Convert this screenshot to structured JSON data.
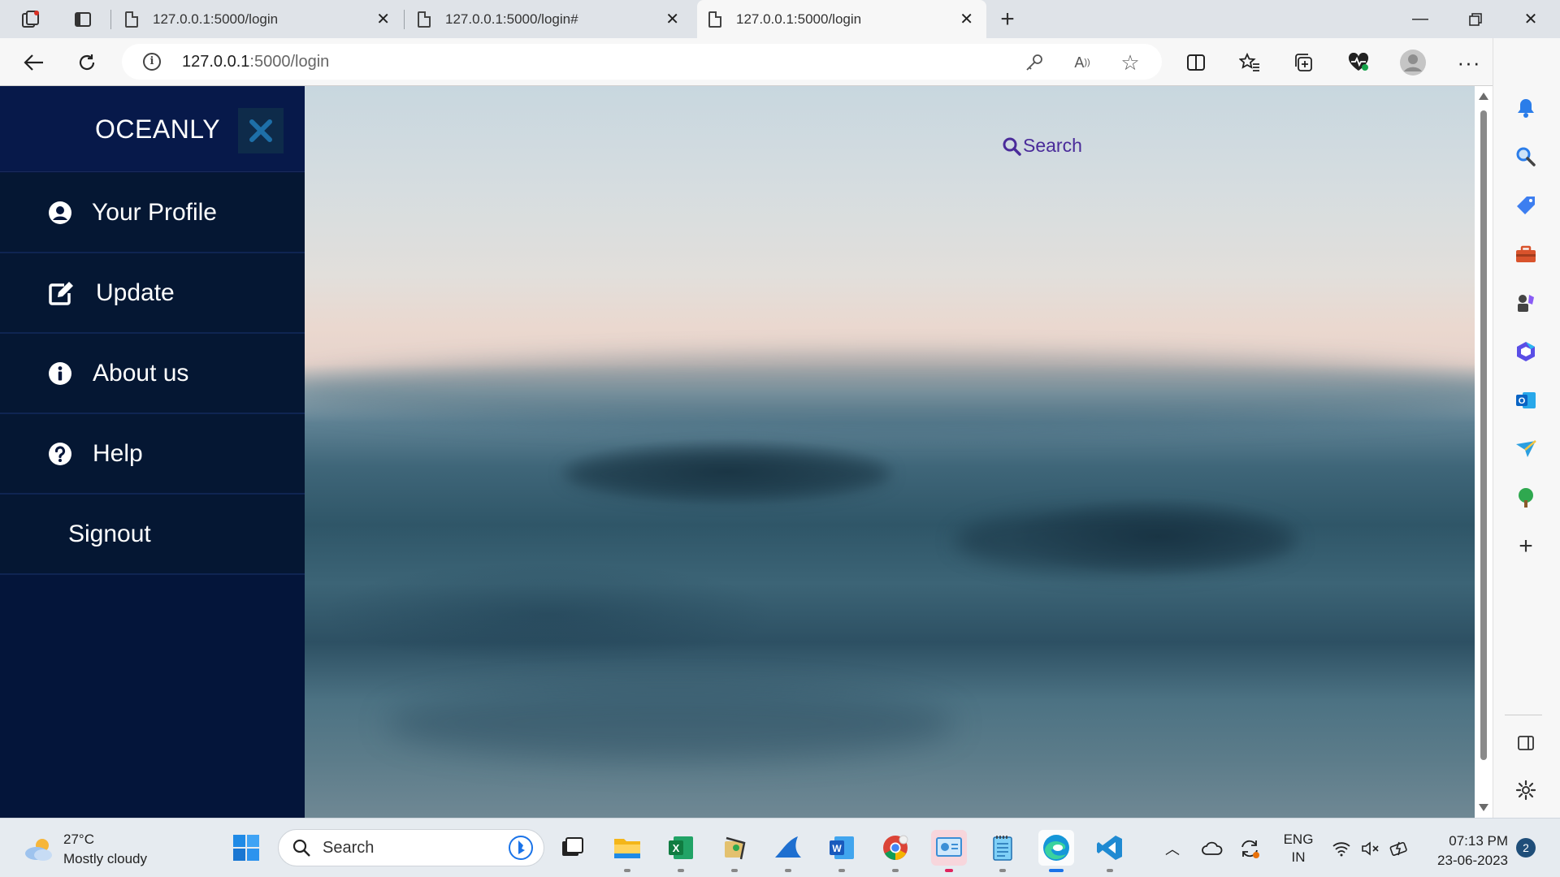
{
  "browser": {
    "tabs": [
      {
        "title": "127.0.0.1:5000/login",
        "active": false
      },
      {
        "title": "127.0.0.1:5000/login#",
        "active": false
      },
      {
        "title": "127.0.0.1:5000/login",
        "active": true
      }
    ],
    "address": {
      "host": "127.0.0.1",
      "rest": ":5000/login"
    }
  },
  "app": {
    "brand": "OCEANLY",
    "search_label": "Search",
    "menu": [
      {
        "label": "Your Profile",
        "icon": "user-circle-icon"
      },
      {
        "label": "Update",
        "icon": "edit-icon"
      },
      {
        "label": "About us",
        "icon": "info-icon"
      },
      {
        "label": "Help",
        "icon": "help-icon"
      },
      {
        "label": "Signout",
        "icon": ""
      }
    ]
  },
  "taskbar": {
    "weather": {
      "temp": "27°C",
      "condition": "Mostly cloudy"
    },
    "search_label": "Search",
    "lang": {
      "line1": "ENG",
      "line2": "IN"
    },
    "clock": {
      "time": "07:13 PM",
      "date": "23-06-2023"
    },
    "notification_count": "2"
  },
  "colors": {
    "sidebar_bg": "#04153a",
    "accent": "#4a2b9a"
  }
}
